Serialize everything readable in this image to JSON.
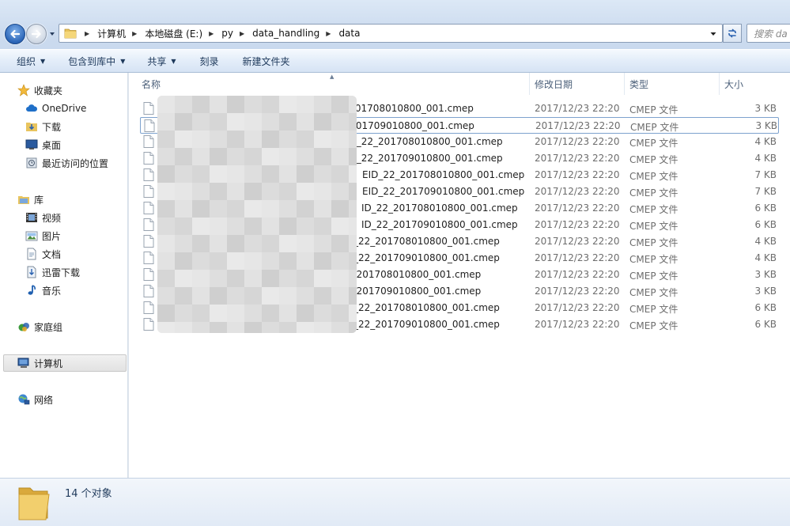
{
  "address": {
    "path": [
      "计算机",
      "本地磁盘 (E:)",
      "py",
      "data_handling",
      "data"
    ],
    "search_placeholder": "搜索 da"
  },
  "toolbar": {
    "organize": "组织",
    "include_library": "包含到库中",
    "share": "共享",
    "burn": "刻录",
    "new_folder": "新建文件夹"
  },
  "nav": {
    "favorites": "收藏夹",
    "onedrive": "OneDrive",
    "downloads": "下载",
    "desktop": "桌面",
    "recent": "最近访问的位置",
    "libraries": "库",
    "videos": "视频",
    "pictures": "图片",
    "documents": "文档",
    "xunlei": "迅雷下载",
    "music": "音乐",
    "homegroup": "家庭组",
    "computer": "计算机",
    "network": "网络"
  },
  "columns": {
    "name": "名称",
    "modified": "修改日期",
    "type": "类型",
    "size": "大小"
  },
  "files": [
    {
      "name": "22_201708010800_001.cmep",
      "date": "2017/12/23 22:20",
      "type": "CMEP 文件",
      "size": "3 KB"
    },
    {
      "name": "22_201709010800_001.cmep",
      "date": "2017/12/23 22:20",
      "type": "CMEP 文件",
      "size": "3 KB"
    },
    {
      "name": "ID_22_201708010800_001.cmep",
      "date": "2017/12/23 22:20",
      "type": "CMEP 文件",
      "size": "4 KB"
    },
    {
      "name": "ID_22_201709010800_001.cmep",
      "date": "2017/12/23 22:20",
      "type": "CMEP 文件",
      "size": "4 KB"
    },
    {
      "name": "EID_22_201708010800_001.cmep",
      "date": "2017/12/23 22:20",
      "type": "CMEP 文件",
      "size": "7 KB"
    },
    {
      "name": "EID_22_201709010800_001.cmep",
      "date": "2017/12/23 22:20",
      "type": "CMEP 文件",
      "size": "7 KB"
    },
    {
      "name": "ID_22_201708010800_001.cmep",
      "date": "2017/12/23 22:20",
      "type": "CMEP 文件",
      "size": "6 KB"
    },
    {
      "name": "ID_22_201709010800_001.cmep",
      "date": "2017/12/23 22:20",
      "type": "CMEP 文件",
      "size": "6 KB"
    },
    {
      "name": "_22_201708010800_001.cmep",
      "date": "2017/12/23 22:20",
      "type": "CMEP 文件",
      "size": "4 KB"
    },
    {
      "name": "_22_201709010800_001.cmep",
      "date": "2017/12/23 22:20",
      "type": "CMEP 文件",
      "size": "4 KB"
    },
    {
      "name": "2_201708010800_001.cmep",
      "date": "2017/12/23 22:20",
      "type": "CMEP 文件",
      "size": "3 KB"
    },
    {
      "name": "2_201709010800_001.cmep",
      "date": "2017/12/23 22:20",
      "type": "CMEP 文件",
      "size": "3 KB"
    },
    {
      "name": "_22_201708010800_001.cmep",
      "date": "2017/12/23 22:20",
      "type": "CMEP 文件",
      "size": "6 KB"
    },
    {
      "name": "_22_201709010800_001.cmep",
      "date": "2017/12/23 22:20",
      "type": "CMEP 文件",
      "size": "6 KB"
    }
  ],
  "status": {
    "count": "14 个对象"
  }
}
